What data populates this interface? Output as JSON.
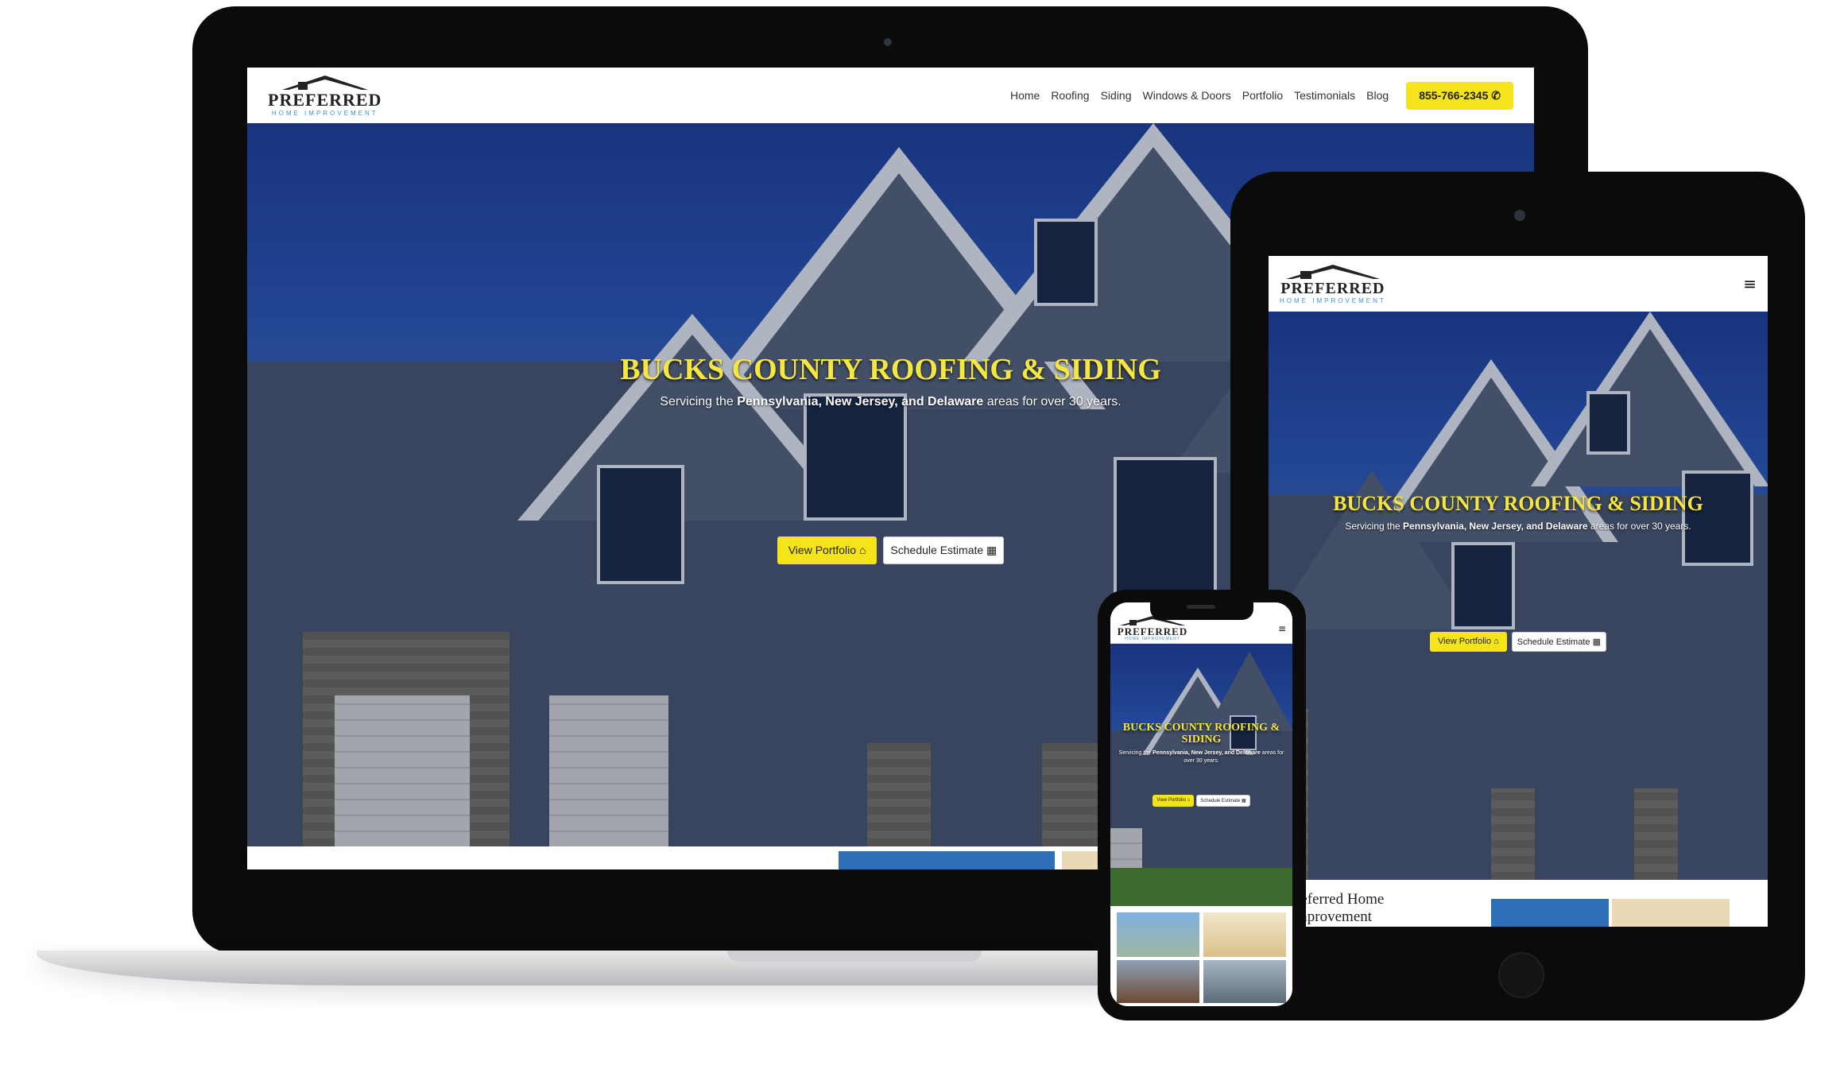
{
  "brand": {
    "logo_main": "PREFERRED",
    "logo_sub": "HOME IMPROVEMENT"
  },
  "nav": {
    "items": [
      "Home",
      "Roofing",
      "Siding",
      "Windows & Doors",
      "Portfolio",
      "Testimonials",
      "Blog"
    ],
    "phone": "855-766-2345",
    "phone_icon": "phone-icon",
    "menu_icon": "hamburger-icon",
    "menu_glyph": "≡"
  },
  "hero": {
    "title": "BUCKS COUNTY ROOFING & SIDING",
    "title_line1": "BUCKS COUNTY ROOFING &",
    "title_line2": "SIDING",
    "subtitle_prefix": "Servicing the",
    "subtitle_bold": "Pennsylvania, New Jersey, and Delaware",
    "subtitle_suffix": "areas for over 30 years.",
    "btn_portfolio": "View Portfolio",
    "btn_portfolio_icon": "home-icon",
    "btn_estimate": "Schedule Estimate",
    "btn_estimate_icon": "calendar-icon"
  },
  "below": {
    "heading_line1": "referred Home",
    "heading_line2": "mprovement"
  },
  "colors": {
    "accent_yellow": "#f5e419",
    "title_yellow": "#f5e640",
    "logo_blue": "#3a8fd4",
    "device_black": "#0b0b0b"
  }
}
